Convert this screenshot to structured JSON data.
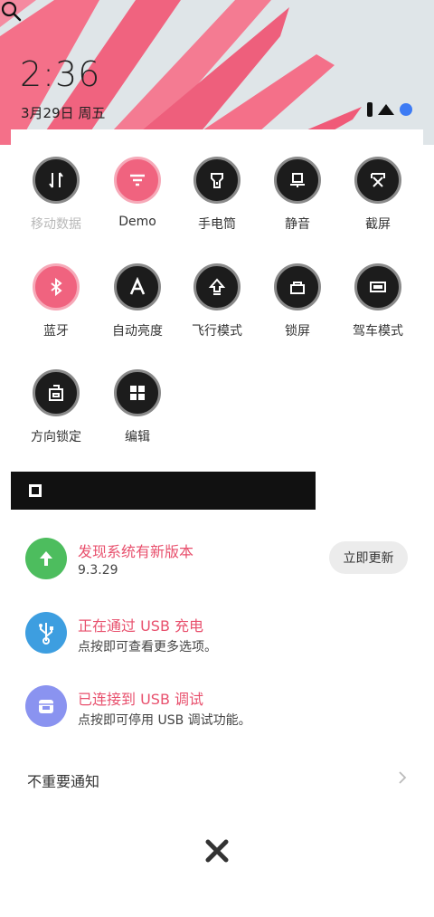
{
  "status": {
    "time": "2:36",
    "date": "3月29日 周五"
  },
  "quick_settings": [
    {
      "label": "移动数据",
      "icon": "swap-vertical-icon",
      "dim": true
    },
    {
      "label": "Demo",
      "icon": "filter-icon",
      "active": true
    },
    {
      "label": "手电筒",
      "icon": "flashlight-icon"
    },
    {
      "label": "静音",
      "icon": "mute-icon"
    },
    {
      "label": "截屏",
      "icon": "screenshot-icon"
    },
    {
      "label": "蓝牙",
      "icon": "bluetooth-icon",
      "active": true
    },
    {
      "label": "自动亮度",
      "icon": "auto-brightness-icon"
    },
    {
      "label": "飞行模式",
      "icon": "airplane-icon"
    },
    {
      "label": "锁屏",
      "icon": "lock-icon"
    },
    {
      "label": "驾车模式",
      "icon": "car-icon"
    },
    {
      "label": "方向锁定",
      "icon": "rotation-lock-icon"
    },
    {
      "label": "编辑",
      "icon": "grid-icon"
    }
  ],
  "notifications": [
    {
      "title": "发现系统有新版本",
      "text": "9.3.29",
      "icon": "arrow-up-icon",
      "color": "#4dbd5e",
      "action": "立即更新"
    },
    {
      "title": "正在通过 USB 充电",
      "text": "点按即可查看更多选项。",
      "icon": "usb-icon",
      "color": "#3d9ee0"
    },
    {
      "title": "已连接到 USB 调试",
      "text": "点按即可停用 USB 调试功能。",
      "icon": "debug-icon",
      "color": "#8a93f0"
    }
  ],
  "footer": {
    "unimportant_label": "不重要通知"
  },
  "colors": {
    "accent_pink": "#f0637f",
    "title_pink": "#e8506d"
  }
}
